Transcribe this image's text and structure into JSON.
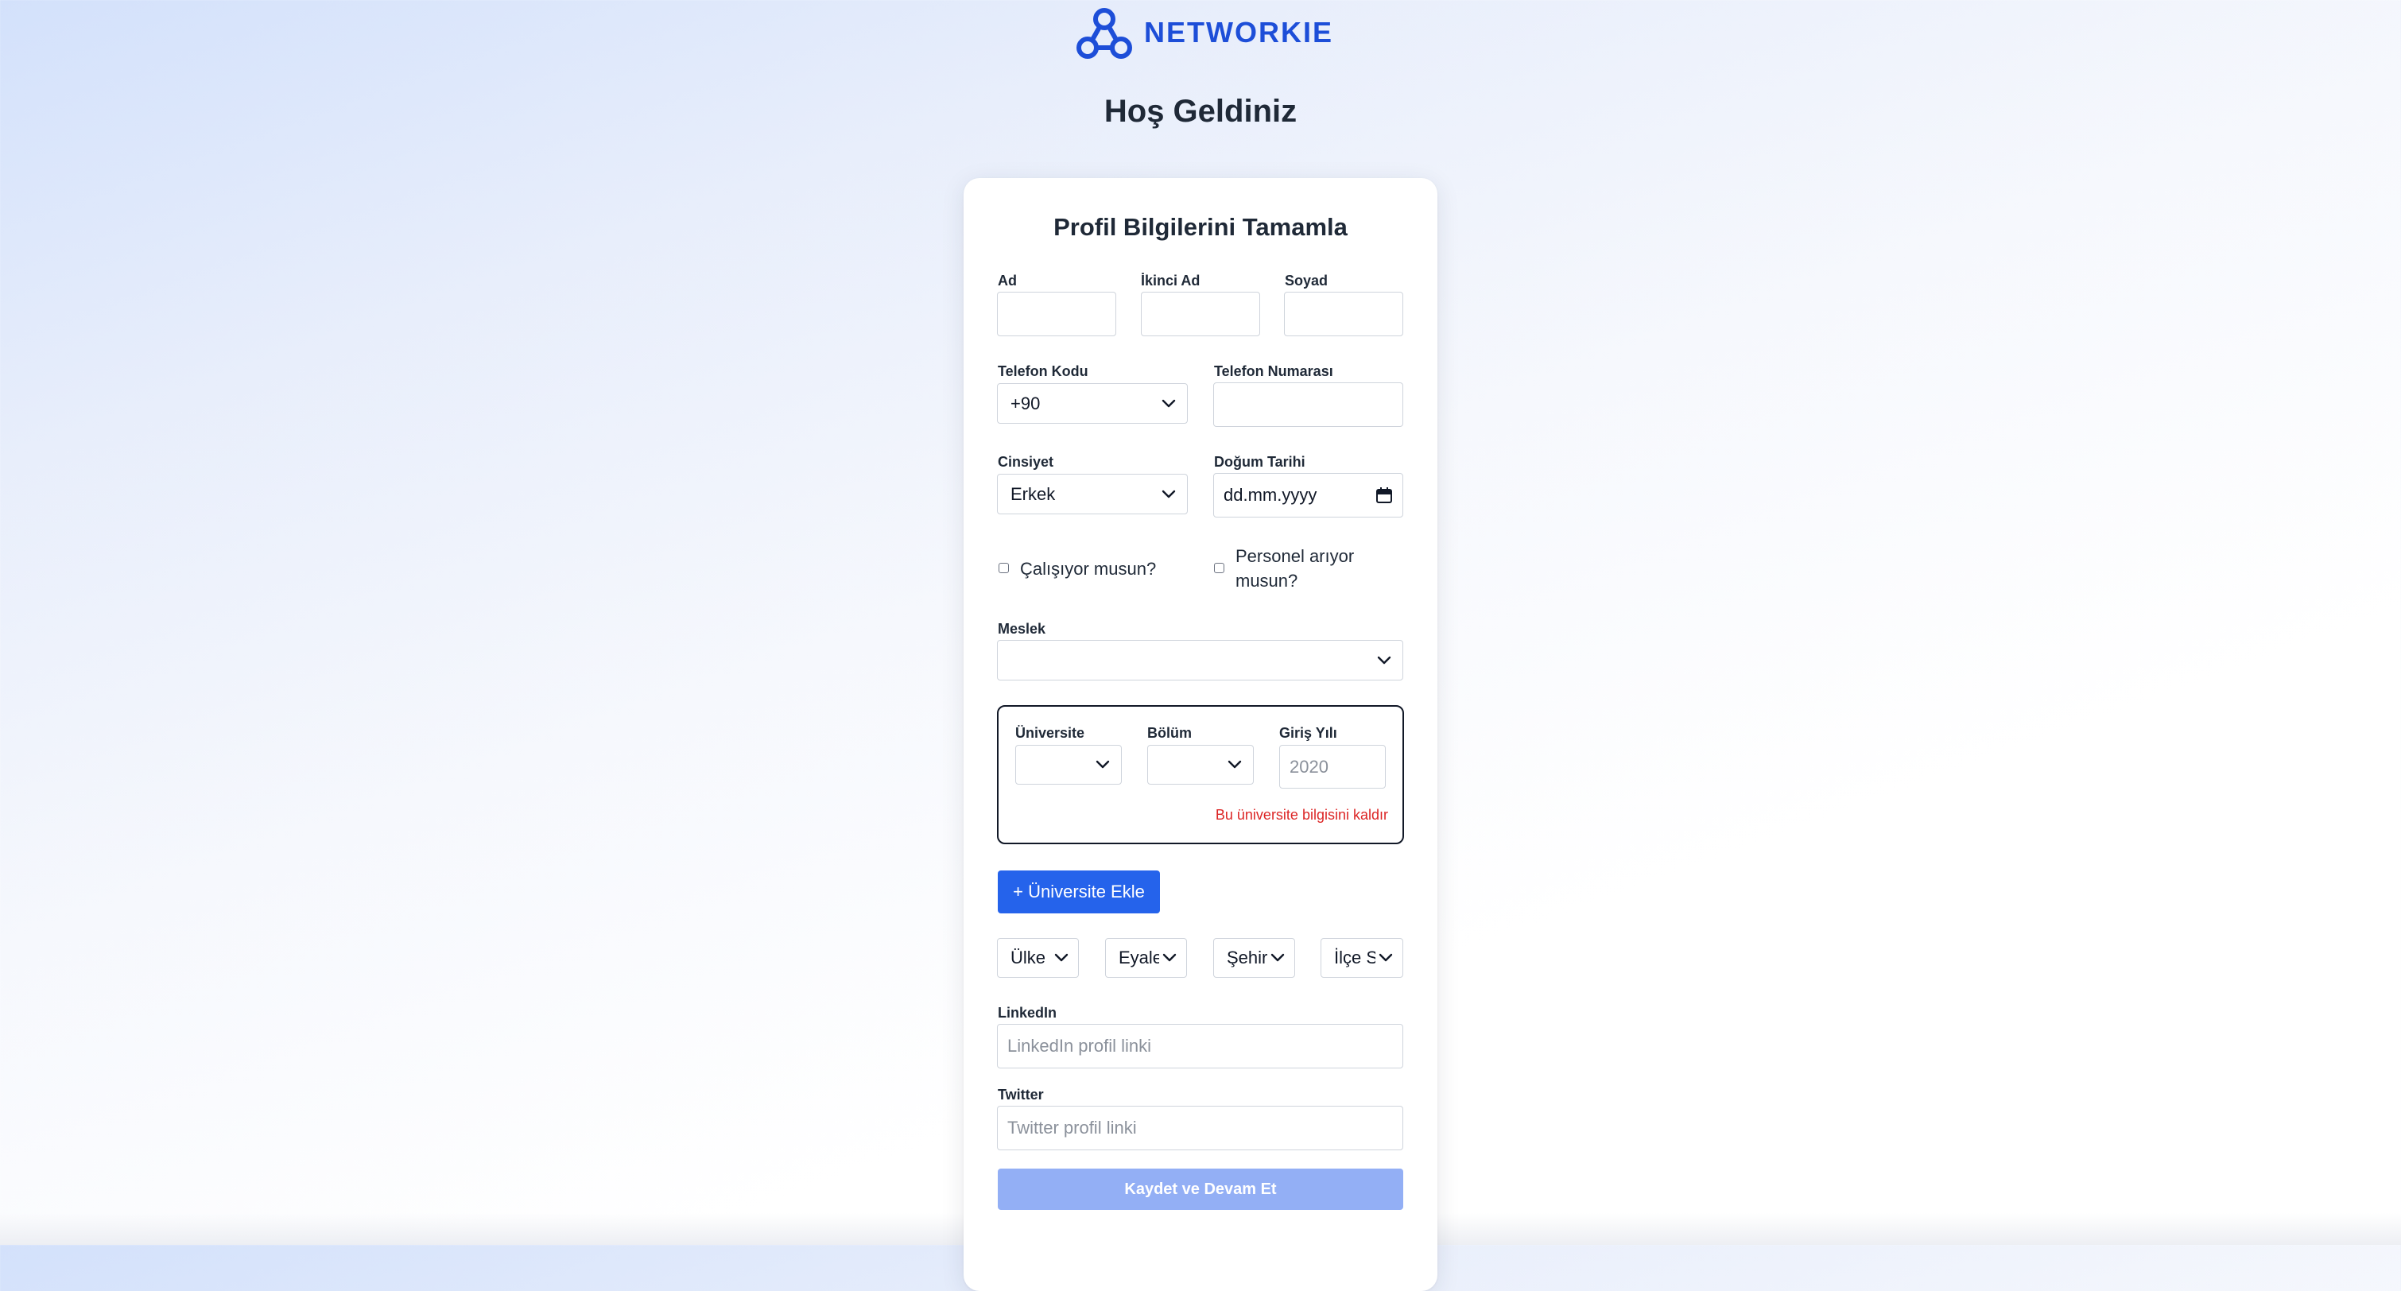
{
  "brand": {
    "name": "NETWORKIE",
    "color": "#1d4ed8",
    "icon": "networkie-logo-icon"
  },
  "page": {
    "title": "Hoş Geldiniz"
  },
  "form": {
    "title": "Profil Bilgilerini Tamamla",
    "first_name": {
      "label": "Ad",
      "value": ""
    },
    "middle_name": {
      "label": "İkinci Ad",
      "value": ""
    },
    "last_name": {
      "label": "Soyad",
      "value": ""
    },
    "phone_code": {
      "label": "Telefon Kodu",
      "selected": "+90"
    },
    "phone_number": {
      "label": "Telefon Numarası",
      "value": ""
    },
    "gender": {
      "label": "Cinsiyet",
      "selected": "Erkek"
    },
    "birth_date": {
      "label": "Doğum Tarihi",
      "value": "dd.mm.yyyy",
      "icon": "calendar-icon"
    },
    "working_checkbox": {
      "label": "Çalışıyor musun?",
      "checked": false
    },
    "hiring_checkbox": {
      "label_line1": "Personel arıyor",
      "label_line2": "musun?",
      "checked": false
    },
    "profession": {
      "label": "Meslek",
      "selected": ""
    },
    "university_entry": {
      "university": {
        "label": "Üniversite",
        "selected": ""
      },
      "department": {
        "label": "Bölüm",
        "selected": ""
      },
      "entry_year": {
        "label": "Giriş Yılı",
        "placeholder": "2020"
      },
      "remove_link": "Bu üniversite bilgisini kaldır"
    },
    "add_university_button": "+ Üniversite Ekle",
    "location": {
      "country": "Ülke",
      "state": "Eyalet",
      "city": "Şehir",
      "district": "İlçe Seçin"
    },
    "linkedin": {
      "label": "LinkedIn",
      "placeholder": "LinkedIn profil linki"
    },
    "twitter": {
      "label": "Twitter",
      "placeholder": "Twitter profil linki"
    },
    "submit_button": "Kaydet ve Devam Et"
  },
  "colors": {
    "primary": "#2563eb",
    "primary_disabled": "#93aff5",
    "danger": "#dc2626",
    "heading": "#1f2937"
  }
}
